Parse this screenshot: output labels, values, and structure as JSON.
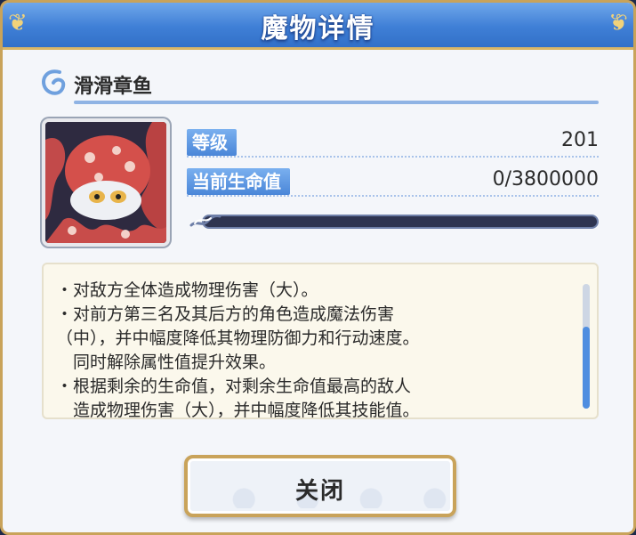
{
  "dialog": {
    "title": "魔物详情",
    "close_label": "关闭"
  },
  "monster": {
    "name": "滑滑章鱼",
    "portrait_icon": "octopus-portrait",
    "level_label": "等级",
    "level_value": "201",
    "hp_label": "当前生命值",
    "hp_value": "0/3800000",
    "hp_fraction": 0.0
  },
  "description": {
    "lines": [
      "・对敌方全体造成物理伤害（大）。",
      "・对前方第三名及其后方的角色造成魔法伤害",
      "（中），并中幅度降低其物理防御力和行动速度。",
      "　同时解除属性值提升效果。",
      "・根据剩余的生命值，对剩余生命值最高的敌人",
      "　造成物理伤害（大），并中幅度降低其技能值。"
    ],
    "scroll_position": 0.35
  },
  "colors": {
    "title_bar": "#3f7fd6",
    "gold_border": "#c9a35a",
    "label_blue": "#4a86d8"
  }
}
